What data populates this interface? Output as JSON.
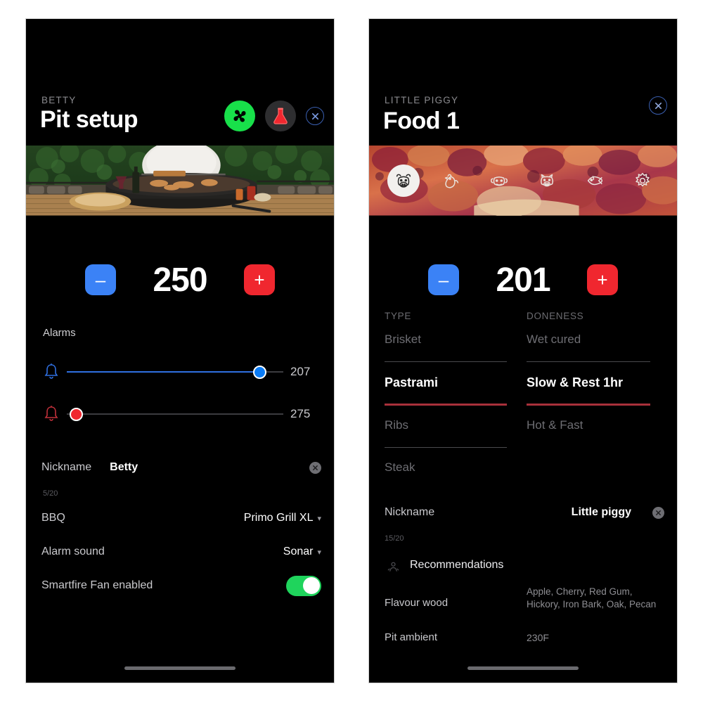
{
  "left_panel": {
    "eyebrow": "BETTY",
    "title": "Pit setup",
    "icons": {
      "fan": "fan-icon",
      "flask": "flask-icon",
      "close": "close-icon"
    },
    "hero_image_alt": "bbq-grill-photo",
    "temperature": {
      "value": "250",
      "minus": "–",
      "plus": "+"
    },
    "alarms_label": "Alarms",
    "alarms": [
      {
        "icon": "bell-icon-blue",
        "value": "207",
        "fill_percent": 89,
        "color": "#0a7bf5"
      },
      {
        "icon": "bell-icon-red",
        "value": "275",
        "fill_percent": 2,
        "color": "#f0272f"
      }
    ],
    "rows": [
      {
        "label": "Nickname",
        "value": "Betty",
        "counter": "5/20"
      },
      {
        "label": "BBQ",
        "value": "Primo Grill XL",
        "caret": "▾"
      },
      {
        "label": "Alarm sound",
        "value": "Sonar",
        "caret": "▾"
      },
      {
        "label": "Smartfire Fan enabled",
        "toggle": true,
        "toggle_on": true
      }
    ]
  },
  "right_panel": {
    "eyebrow": "LITTLE PIGGY",
    "title": "Food 1",
    "icons": {
      "close": "close-icon"
    },
    "hero_image_alt": "glazed-meat-photo",
    "animals": [
      {
        "name": "cow-icon",
        "selected": true
      },
      {
        "name": "chicken-icon",
        "selected": false
      },
      {
        "name": "lamb-icon",
        "selected": false
      },
      {
        "name": "pig-icon",
        "selected": false
      },
      {
        "name": "fish-icon",
        "selected": false
      },
      {
        "name": "vegetable-icon",
        "selected": false
      }
    ],
    "temperature": {
      "value": "201",
      "minus": "–",
      "plus": "+"
    },
    "type_column": {
      "header": "TYPE",
      "options": [
        "Brisket",
        "Pastrami",
        "Ribs",
        "Steak"
      ],
      "selected": "Pastrami"
    },
    "doneness_column": {
      "header": "DONENESS",
      "options": [
        "Wet cured",
        "Slow & Rest 1hr",
        "Hot & Fast"
      ],
      "selected": "Slow & Rest 1hr"
    },
    "rows": [
      {
        "label": "Nickname",
        "value": "Little piggy",
        "counter": "15/20"
      },
      {
        "label": "Recommendations",
        "is_header": true
      },
      {
        "label": "Flavour wood",
        "value": "Apple, Cherry, Red Gum, Hickory, Iron Bark, Oak, Pecan"
      },
      {
        "label": "Pit ambient",
        "value": "230F"
      }
    ]
  },
  "theme": {
    "bg": "#000000",
    "accent_blue": "#3b82f6",
    "accent_red": "#f0272f",
    "accent_green": "#18e04a",
    "toggle_green": "#1fd45c",
    "selected_underline": "#a8303a"
  }
}
